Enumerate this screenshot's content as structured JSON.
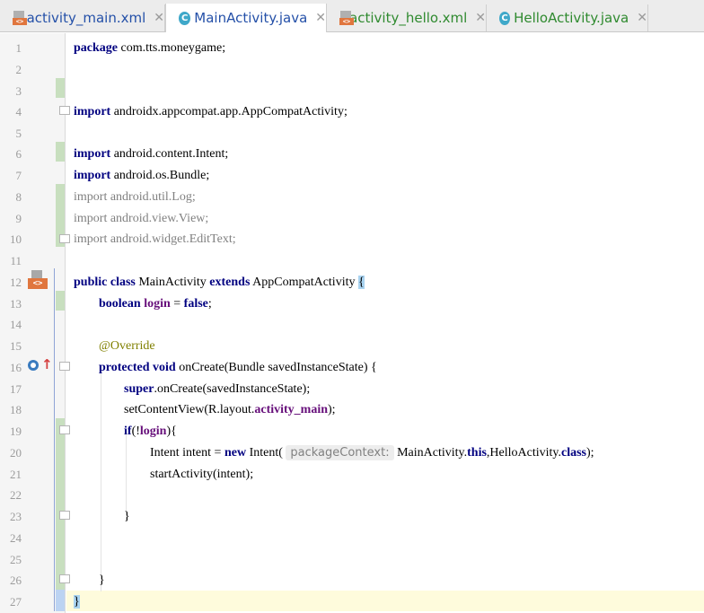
{
  "tabs": [
    {
      "label": "activity_main.xml",
      "icon": "xml-file-icon",
      "color": "#2450a8",
      "close": "✕"
    },
    {
      "label": "MainActivity.java",
      "icon": "java-class-icon",
      "color": "#2450a8",
      "close": "✕",
      "active": true
    },
    {
      "label": "activity_hello.xml",
      "icon": "xml-file-icon",
      "color": "#2f8a2f",
      "close": "✕"
    },
    {
      "label": "HelloActivity.java",
      "icon": "java-class-icon",
      "color": "#2f8a2f",
      "close": "✕"
    }
  ],
  "line_numbers": [
    "1",
    "2",
    "3",
    "4",
    "5",
    "6",
    "7",
    "8",
    "9",
    "10",
    "11",
    "12",
    "13",
    "14",
    "15",
    "16",
    "17",
    "18",
    "19",
    "20",
    "21",
    "22",
    "23",
    "24",
    "25",
    "26",
    "27"
  ],
  "code": {
    "l0_kw": "package",
    "l0_rest": " com.tts.moneygame;",
    "l4_kw": "import",
    "l4_rest": " androidx.appcompat.app.AppCompatActivity;",
    "l6_kw": "import",
    "l6_rest": " android.content.Intent;",
    "l7_kw": "import",
    "l7_rest": " android.os.Bundle;",
    "l8_kw": "import",
    "l8_rest": " android.util.Log;",
    "l9_kw": "import",
    "l9_rest": " android.view.View;",
    "l10_kw": "import",
    "l10_rest": " android.widget.EditText;",
    "l12_kw1": "public",
    "l12_kw2": "class",
    "l12_name": " MainActivity ",
    "l12_kw3": "extends",
    "l12_rest": " AppCompatActivity ",
    "l12_brace": "{",
    "l13_kw": "boolean",
    "l13_field": "login",
    "l13_eq": " = ",
    "l13_val": "false",
    "l13_semi": ";",
    "l15_ann": "@Override",
    "l16_kw1": "protected",
    "l16_kw2": "void",
    "l16_rest": " onCreate(Bundle savedInstanceState) {",
    "l17_kw": "super",
    "l17_rest": ".onCreate(savedInstanceState);",
    "l18_pre": "setContentView(R.layout.",
    "l18_field": "activity_main",
    "l18_post": ");",
    "l19_kw": "if",
    "l19_pre": "(!",
    "l19_field": "login",
    "l19_post": "){",
    "l20_pre": "Intent intent = ",
    "l20_kw": "new",
    "l20_mid": " Intent(",
    "l20_hint": "packageContext:",
    "l20_a": " MainActivity.",
    "l20_this": "this",
    "l20_b": ",HelloActivity.",
    "l20_class": "class",
    "l20_end": ");",
    "l21": "startActivity(intent);",
    "l23": "}",
    "l26": "}",
    "l27": "}"
  }
}
